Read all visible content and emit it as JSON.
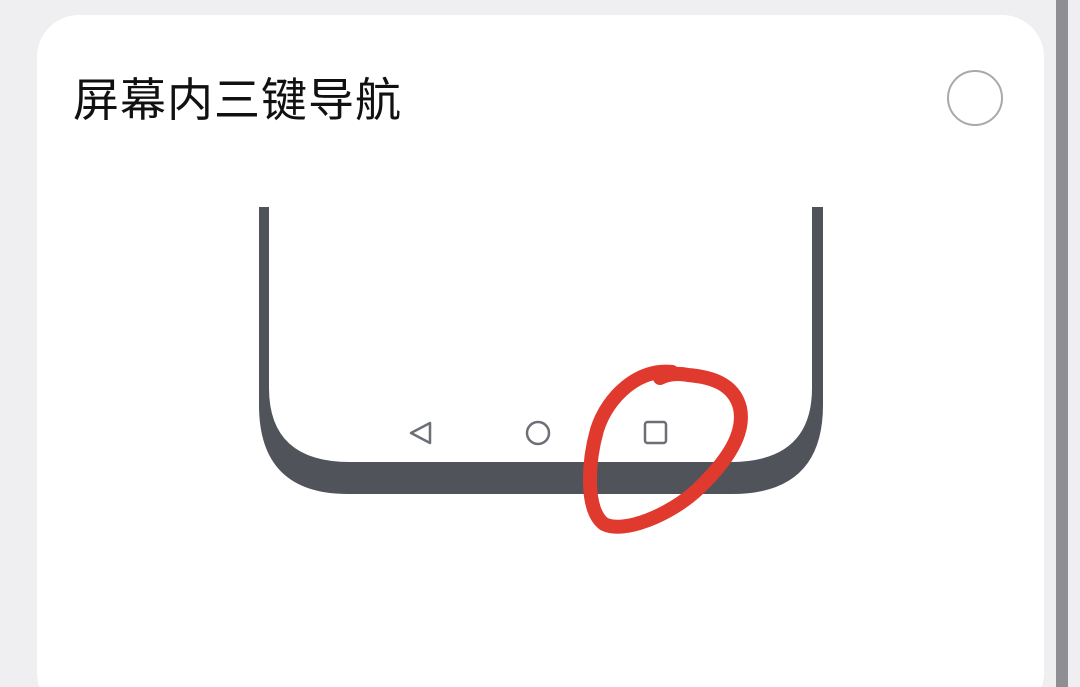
{
  "option": {
    "title": "屏幕内三键导航",
    "selected": false
  },
  "navbar": {
    "buttons": [
      {
        "name": "back",
        "icon": "back-triangle-icon"
      },
      {
        "name": "home",
        "icon": "home-circle-icon"
      },
      {
        "name": "recents",
        "icon": "recents-square-icon"
      }
    ]
  },
  "colors": {
    "background": "#efeff1",
    "card": "#ffffff",
    "phone_frame": "#50535a",
    "icon_stroke": "#6c6f76",
    "annotation": "#e03a2e",
    "radio_border": "#a9a9ad",
    "scrollbar": "#8e8e93"
  }
}
